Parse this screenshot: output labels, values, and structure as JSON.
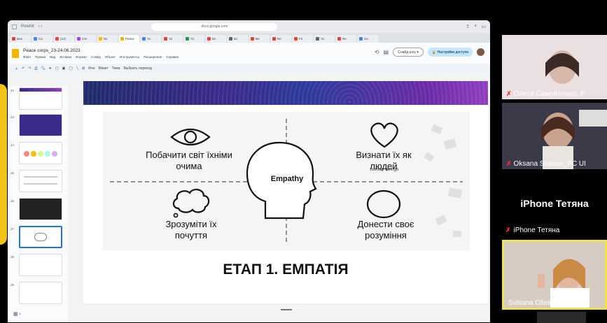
{
  "browser": {
    "back_tab_label": "Powrót",
    "url": "docs.google.com",
    "tabs": [
      {
        "label": "Boo",
        "color": "#db4437"
      },
      {
        "label": "Ca",
        "color": "#4285f4"
      },
      {
        "label": "(12)",
        "color": "#ea4335"
      },
      {
        "label": "Cre",
        "color": "#a142f4"
      },
      {
        "label": "Nx",
        "color": "#fbbc04"
      },
      {
        "label": "Peace",
        "color": "#f4b400"
      },
      {
        "label": "Yo",
        "color": "#4285f4"
      },
      {
        "label": "Yo",
        "color": "#ea4335"
      },
      {
        "label": "Yo",
        "color": "#0f9d58"
      },
      {
        "label": "En",
        "color": "#db4437"
      },
      {
        "label": "Ex",
        "color": "#5f6368"
      },
      {
        "label": "Be",
        "color": "#db4437"
      },
      {
        "label": "Re",
        "color": "#db4437"
      },
      {
        "label": "Fir",
        "color": "#ea4335"
      },
      {
        "label": "Yo",
        "color": "#5f6368"
      },
      {
        "label": "Re",
        "color": "#db4437"
      },
      {
        "label": "Go",
        "color": "#4285f4"
      }
    ]
  },
  "slides_app": {
    "doc_title": "Peace corps_23-24.06.2023",
    "menus": [
      "Файл",
      "Правка",
      "Вид",
      "Вставка",
      "Формат",
      "Слайд",
      "Объект",
      "Инструменты",
      "Расширения",
      "Справка"
    ],
    "slideshow_label": "Слайд-шоу",
    "share_label": "Настройки доступа",
    "toolbar_items": [
      "Фон",
      "Макет",
      "Тема",
      "Выбрать переход"
    ],
    "thumb_numbers": [
      "22",
      "23",
      "24",
      "25",
      "26",
      "27",
      "28",
      "29",
      "30"
    ]
  },
  "slide": {
    "center_label": "Empathy",
    "q1": "Побачити світ їхніми очима",
    "q2": "Визнати їх як людей",
    "q2_overlay": "human beings",
    "q3": "Зрозуміти їх почуття",
    "q4": "Донести своє розуміння",
    "title": "ЕТАП 1. ЕМПАТІЯ"
  },
  "participants": [
    {
      "name": "Олеся Самойленко, Р",
      "muted": true
    },
    {
      "name": "Oksana Shabas_PC UI",
      "muted": true
    },
    {
      "name": "iPhone Тетяна",
      "display": "iPhone Тетяна",
      "muted": true
    },
    {
      "name": "Svitiana Olieinikova",
      "muted": false
    }
  ],
  "colors": {
    "accent_blue": "#1a73e8",
    "mic_off": "#e33333",
    "speaker_border": "#f2e24a",
    "brand_yellow": "#f2c317"
  }
}
